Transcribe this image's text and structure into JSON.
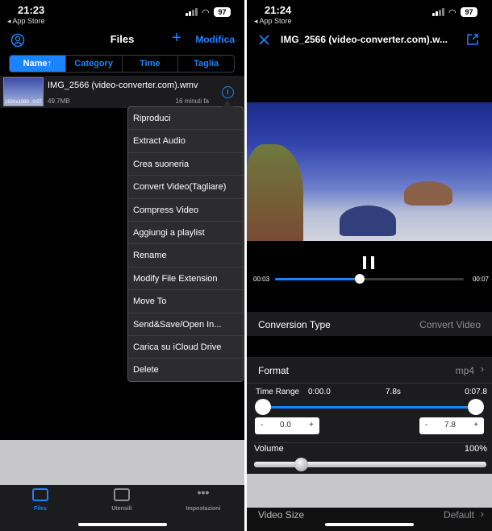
{
  "left": {
    "status": {
      "time": "21:23",
      "back": "◂ App Store",
      "battery": "97"
    },
    "nav": {
      "title": "Files",
      "add": "+",
      "edit": "Modifica"
    },
    "sort_tabs": [
      "Name↑",
      "Category",
      "Time",
      "Taglia"
    ],
    "file": {
      "name": "IMG_2566 (video-converter.com).wmv",
      "size": "49.7MB",
      "date": "16 minuti fa",
      "thumb_res": "1920x1080",
      "thumb_dur": "0:07"
    },
    "menu": [
      "Riproduci",
      "Extract Audio",
      "Crea suoneria",
      "Convert Video(Tagliare)",
      "Compress Video",
      "Aggiungi a playlist",
      "Rename",
      "Modify File Extension",
      "Move To",
      "Send&Save/Open In...",
      "Carica su iCloud Drive",
      "Delete"
    ],
    "tabs": [
      {
        "label": "Files",
        "icon": "folder-icon",
        "active": true
      },
      {
        "label": "Utensili",
        "icon": "tools-icon",
        "active": false
      },
      {
        "label": "Impostazioni",
        "icon": "more-icon",
        "active": false
      }
    ]
  },
  "right": {
    "status": {
      "time": "21:24",
      "back": "◂ App Store",
      "battery": "97"
    },
    "nav": {
      "title": "IMG_2566 (video-converter.com).w..."
    },
    "player": {
      "current": "00:03",
      "total": "00:07",
      "progress": 0.45
    },
    "conversion": {
      "label": "Conversion Type",
      "value": "Convert Video"
    },
    "format": {
      "label": "Format",
      "value": "mp4"
    },
    "time_range": {
      "label": "Time Range",
      "start": "0:00.0",
      "duration": "7.8s",
      "end": "0:07.8",
      "start_value": "0.0",
      "end_value": "7.8"
    },
    "volume": {
      "label": "Volume",
      "value": "100%",
      "level": 0.2
    },
    "video_size": {
      "label": "Video Size",
      "value": "Default"
    }
  },
  "colors": {
    "accent": "#1a84ff",
    "background": "#000000",
    "panel": "#1c1c1e"
  }
}
